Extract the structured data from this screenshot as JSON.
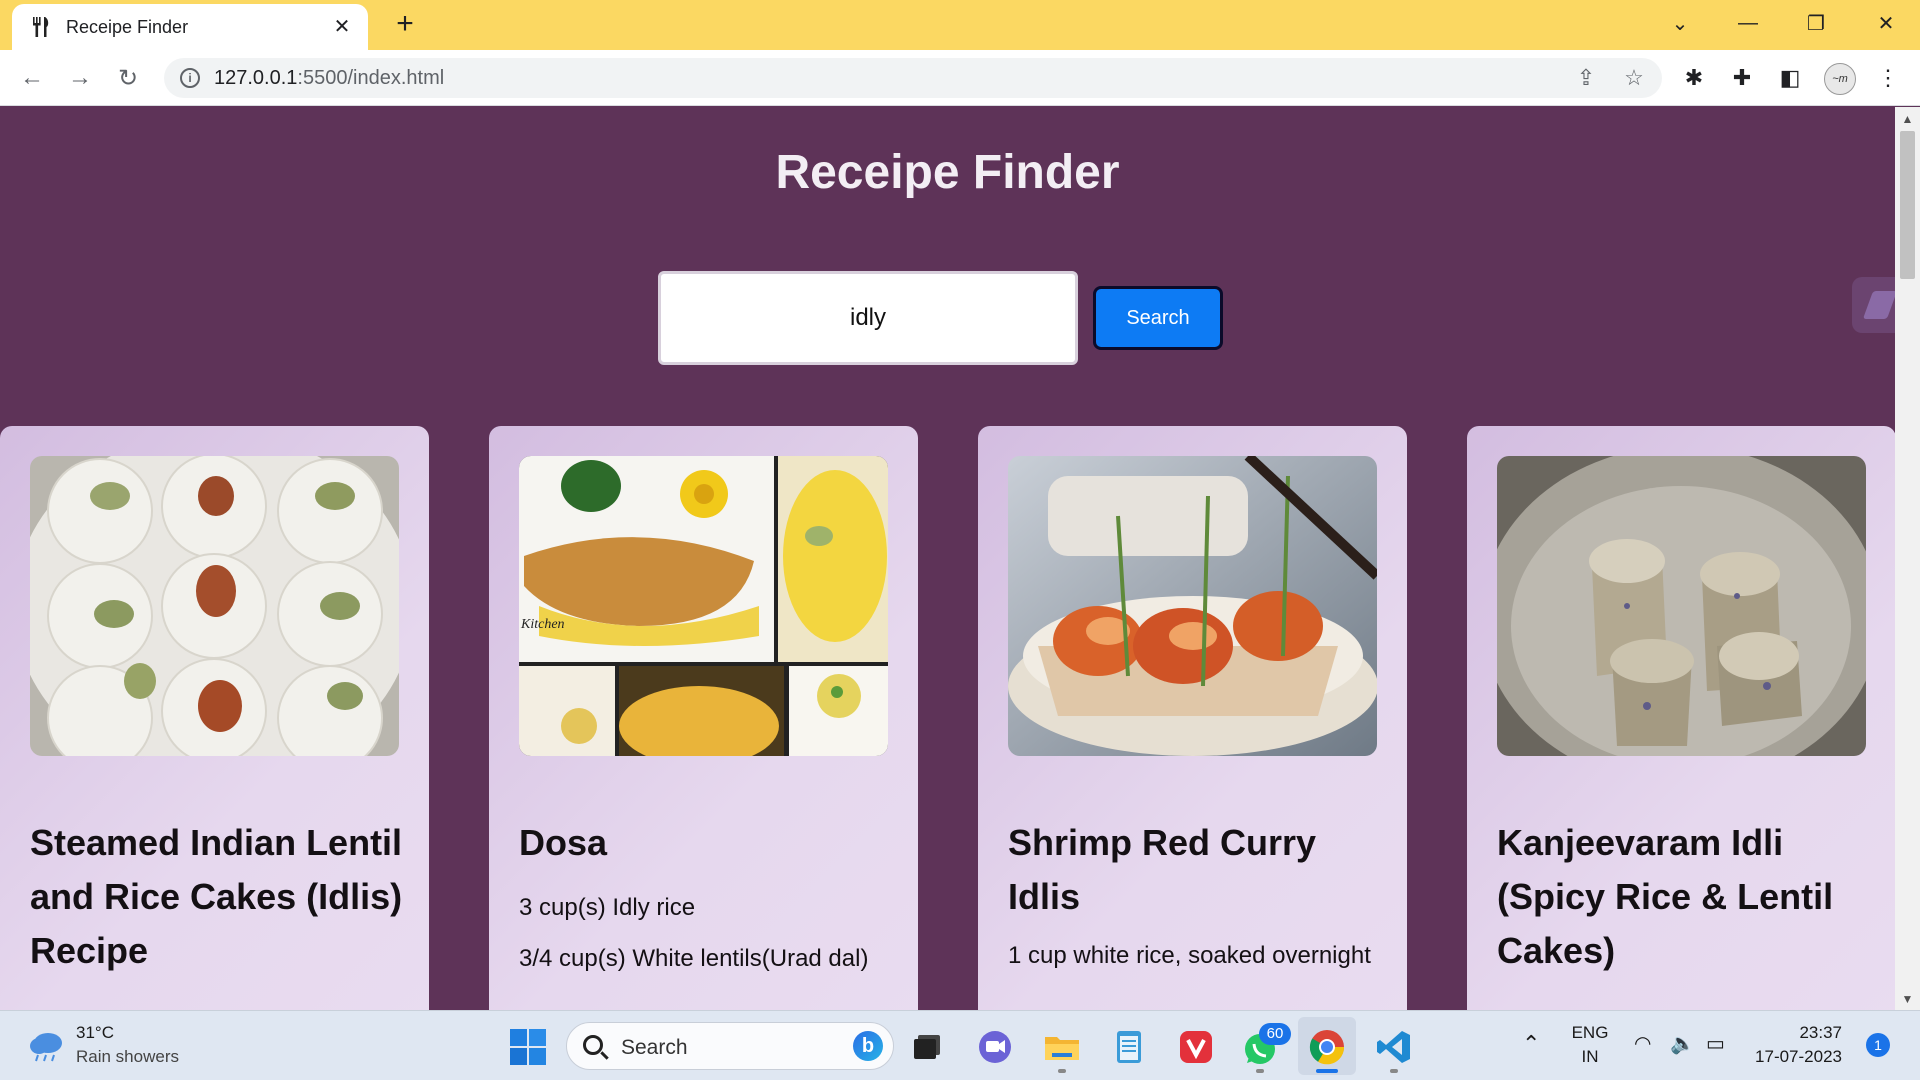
{
  "browser": {
    "tab_title": "Receipe Finder",
    "url_host": "127.0.0.1",
    "url_rest": ":5500/index.html"
  },
  "page": {
    "title": "Receipe Finder",
    "search_value": "idly",
    "search_button": "Search"
  },
  "cards": [
    {
      "title": "Steamed Indian Lentil and Rice Cakes (Idlis) Recipe",
      "lines": []
    },
    {
      "title": "Dosa",
      "lines": [
        "3 cup(s) Idly rice",
        "3/4 cup(s) White lentils(Urad dal)"
      ]
    },
    {
      "title": "Shrimp Red Curry Idlis",
      "lines": [
        "1 cup white rice, soaked overnight"
      ]
    },
    {
      "title": "Kanjeevaram Idli (Spicy Rice & Lentil Cakes)",
      "lines": []
    }
  ],
  "taskbar": {
    "weather_temp": "31°C",
    "weather_desc": "Rain showers",
    "search_label": "Search",
    "whatsapp_badge": "60",
    "lang_top": "ENG",
    "lang_bottom": "IN",
    "time": "23:37",
    "date": "17-07-2023",
    "notifications": "1"
  },
  "colors": {
    "page_bg": "#5e3358",
    "card_bg": "#e3d2ec",
    "search_button": "#0d7bf4",
    "titlebar": "#fbd862"
  }
}
